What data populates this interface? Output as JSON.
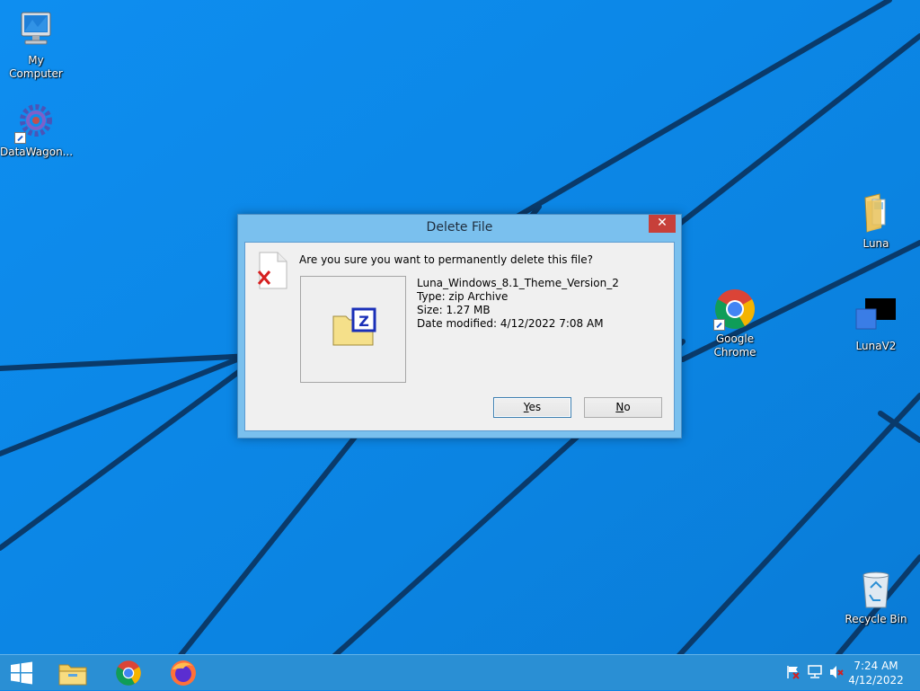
{
  "desktop": {
    "icons": [
      {
        "label": "My Computer",
        "icon": "computer-icon"
      },
      {
        "label": "DataWagon...",
        "icon": "gear-shortcut-icon"
      },
      {
        "label": "Luna",
        "icon": "folder-icon"
      },
      {
        "label": "Google Chrome",
        "icon": "chrome-icon"
      },
      {
        "label": "LunaV2",
        "icon": "shortcut-icon"
      },
      {
        "label": "Recycle Bin",
        "icon": "recycle-bin-icon"
      }
    ]
  },
  "dialog": {
    "title": "Delete File",
    "close_label": "✕",
    "question": "Are you sure you want to permanently delete this file?",
    "file": {
      "name": "Luna_Windows_8.1_Theme_Version_2",
      "type": "Type: zip Archive",
      "size": "Size: 1.27 MB",
      "date_modified": "Date modified: 4/12/2022 7:08 AM"
    },
    "buttons": {
      "yes_access": "Y",
      "yes_rest": "es",
      "no_access": "N",
      "no_rest": "o"
    }
  },
  "taskbar": {
    "pinned": [
      "start-icon",
      "file-explorer-icon",
      "chrome-icon",
      "firefox-icon"
    ],
    "tray": [
      "flag-icon",
      "network-icon",
      "volume-muted-icon"
    ],
    "clock": {
      "time": "7:24 AM",
      "date": "4/12/2022"
    }
  },
  "colors": {
    "wallpaper": "#0d86e3",
    "taskbar": "#2a8fd4",
    "dialog_frame": "#7ac0ee",
    "close_button": "#c7403a"
  }
}
